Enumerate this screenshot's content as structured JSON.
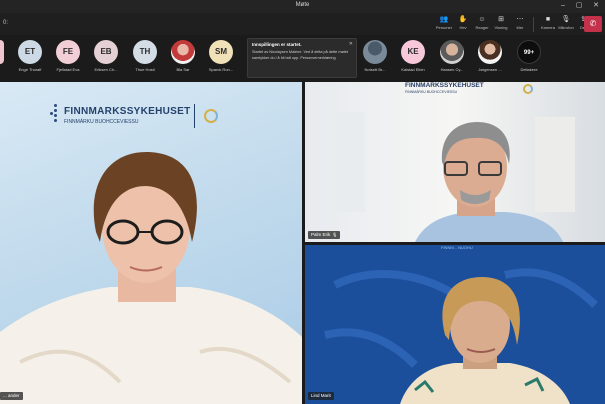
{
  "window": {
    "title": "Møte"
  },
  "toolbar": {
    "left_tag": "0:",
    "buttons": [
      {
        "id": "people",
        "icon": "people-icon",
        "glyph": "👥",
        "label": "Personer"
      },
      {
        "id": "raise",
        "icon": "raise-hand-icon",
        "glyph": "✋",
        "label": "Hev"
      },
      {
        "id": "react",
        "icon": "react-icon",
        "glyph": "☺",
        "label": "Reager"
      },
      {
        "id": "view",
        "icon": "view-icon",
        "glyph": "⊞",
        "label": "Visning"
      },
      {
        "id": "more",
        "icon": "more-icon",
        "glyph": "⋯",
        "label": "Mer"
      },
      {
        "id": "camera",
        "icon": "camera-icon",
        "glyph": "■",
        "label": "Kamera"
      },
      {
        "id": "mic",
        "icon": "microphone-icon",
        "glyph": "🎙",
        "label": "Mikrofon"
      },
      {
        "id": "share",
        "icon": "share-icon",
        "glyph": "⇪",
        "label": "Del"
      }
    ],
    "leave_glyph": "✆"
  },
  "participants": [
    {
      "initials": "ET",
      "name": "Enge Thoralf",
      "cls": "av-et",
      "left": 0
    },
    {
      "initials": "FE",
      "name": "Fjellstad Eva",
      "cls": "av-fe",
      "left": 0
    },
    {
      "initials": "EB",
      "name": "Eriksen Ch...",
      "cls": "av-eb",
      "left": 0
    },
    {
      "initials": "TH",
      "name": "Thue Hosti",
      "cls": "av-th",
      "left": 0
    },
    {
      "initials": "",
      "name": "Bla Sar",
      "cls": "av-photo1",
      "left": 0
    },
    {
      "initials": "SM",
      "name": "Sparck Ron...",
      "cls": "av-sm",
      "left": 0
    },
    {
      "initials": "",
      "name": "Notsett Br...",
      "cls": "av-photo2",
      "left": 0
    },
    {
      "initials": "KE",
      "name": "Kalstad Ellen",
      "cls": "av-ke",
      "left": 0
    },
    {
      "initials": "",
      "name": "Hansen Cy...",
      "cls": "av-photo3",
      "left": 0
    },
    {
      "initials": "",
      "name": "Jørgensen ...",
      "cls": "av-photo4",
      "left": 0
    },
    {
      "initials": "99+",
      "name": "Deltakere",
      "cls": "av-more",
      "left": 0
    }
  ],
  "notification": {
    "title": "Innspillingen er startet.",
    "body": "Startet av Nicolaysen Malene. Ved å delta på dette møtet samtykker du i å bli tatt opp. Personvernerklæring"
  },
  "videos": {
    "main": {
      "name": "... ander",
      "logo_line1": "FINNMARKSSYKEHUSET",
      "logo_line2": "FINNMÁRKU BUOHCCEVIESSU"
    },
    "top_right": {
      "name": "Palm Erik",
      "logo_line1": "FINNMARKSSYKEHUSET",
      "logo_line2": "FINNMÁRKU BUOHCCEVIESSU"
    },
    "bottom_right": {
      "name": "Lind Marit",
      "logo_line1": "FINNM... NUOHU"
    }
  },
  "colors": {
    "accent": "#6264a7",
    "leave": "#c4314b",
    "tile_blue": "#1b4f9c"
  }
}
